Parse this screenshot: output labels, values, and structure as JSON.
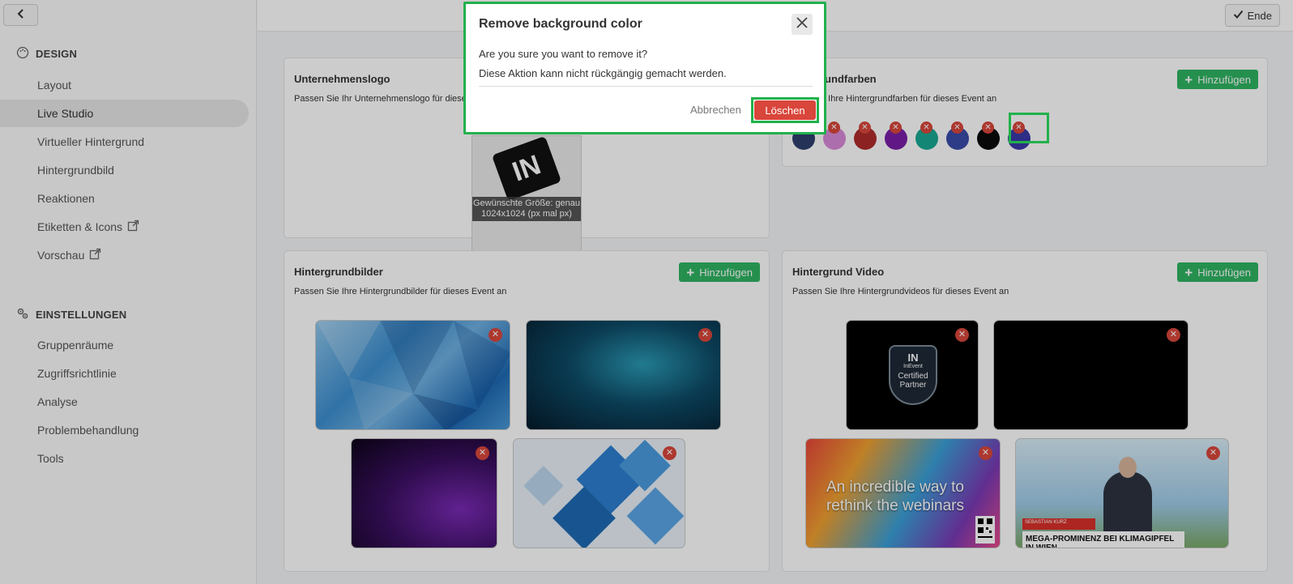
{
  "sidebar": {
    "back_icon": "chevron-left-icon",
    "design_heading": "DESIGN",
    "design_items": [
      {
        "label": "Layout"
      },
      {
        "label": "Live Studio",
        "active": true
      },
      {
        "label": "Virtueller Hintergrund"
      },
      {
        "label": "Hintergrundbild"
      },
      {
        "label": "Reaktionen"
      },
      {
        "label": "Etiketten & Icons",
        "external": true
      },
      {
        "label": "Vorschau",
        "external": true
      }
    ],
    "settings_heading": "EINSTELLUNGEN",
    "settings_items": [
      {
        "label": "Gruppenräume"
      },
      {
        "label": "Zugriffsrichtlinie"
      },
      {
        "label": "Analyse"
      },
      {
        "label": "Problembehandlung"
      },
      {
        "label": "Tools"
      }
    ]
  },
  "topbar": {
    "end_label": "Ende"
  },
  "logo_card": {
    "title": "Unternehmenslogo",
    "desc": "Passen Sie Ihr Unternehmenslogo für dieses",
    "logo_caption": "Gewünschte Größe: genau 1024x1024 (px mal px)",
    "logo_text": "IN"
  },
  "colors_card": {
    "title": "rundfarben",
    "desc": "e Ihre Hintergrundfarben für dieses Event an",
    "add_label": "Hinzufügen",
    "swatches": [
      "#2e3f6e",
      "#d98ad9",
      "#b02b2b",
      "#7a1fa8",
      "#1aa893",
      "#3a4aa8",
      "#0a0a0a",
      "#3a3aa8"
    ]
  },
  "images_card": {
    "title": "Hintergrundbilder",
    "desc": "Passen Sie Ihre Hintergrundbilder für dieses Event an",
    "add_label": "Hinzufügen"
  },
  "video_card": {
    "title": "Hintergrund Video",
    "desc": "Passen Sie Ihre Hintergrundvideos für dieses Event an",
    "add_label": "Hinzufügen",
    "badge_brand": "InEvent",
    "badge_line1": "Certified",
    "badge_line2": "Partner",
    "promo_text": "An incredible way to rethink the webinars",
    "news_ticker": "MEGA-PROMINENZ BEI KLIMAGIPFEL IN WIEN",
    "news_name": "SEBASTIAN KURZ"
  },
  "dialog": {
    "title": "Remove background color",
    "line1": "Are you sure you want to remove it?",
    "line2": "Diese Aktion kann nicht rückgängig gemacht werden.",
    "cancel_label": "Abbrechen",
    "delete_label": "Löschen"
  },
  "colors": {
    "accent_green": "#2fb562",
    "danger_red": "#d9463b",
    "highlight_green": "#22b14c"
  }
}
